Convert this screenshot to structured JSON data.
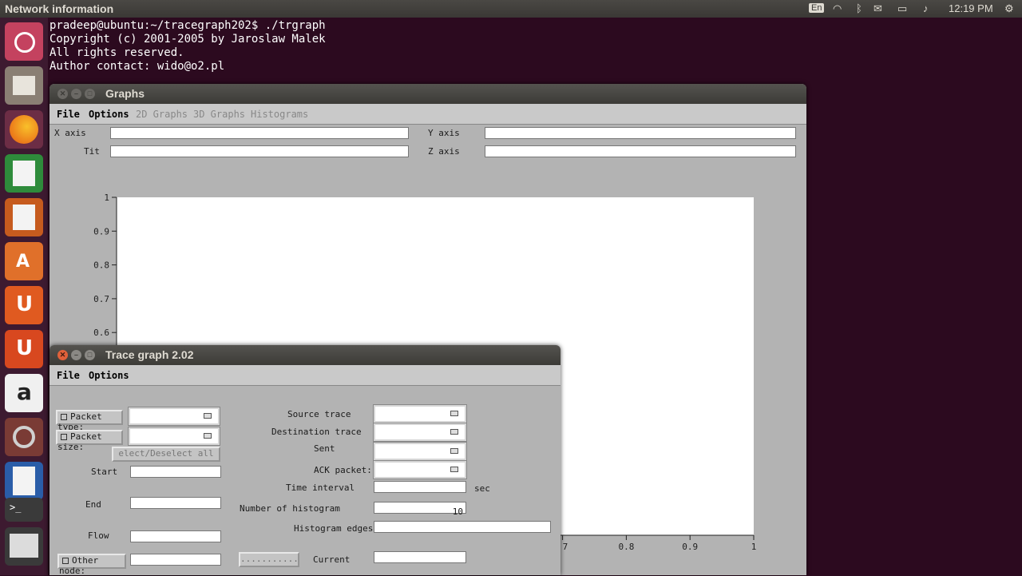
{
  "topbar": {
    "title": "Network information",
    "lang": "En",
    "time": "12:19 PM"
  },
  "terminal": {
    "lines": [
      "pradeep@ubuntu:~/tracegraph202$ ./trgraph",
      "Copyright (c) 2001-2005 by Jaroslaw Malek",
      "All rights reserved.",
      "Author contact: wido@o2.pl"
    ]
  },
  "graphs": {
    "title": "Graphs",
    "menu": {
      "file": "File",
      "options": "Options",
      "g2d": "2D Graphs",
      "g3d": "3D Graphs",
      "hist": "Histograms"
    },
    "xaxis": "X axis",
    "yaxis": "Y axis",
    "tit": "Tit",
    "zaxis": "Z axis"
  },
  "chart_data": {
    "type": "line",
    "series": [],
    "xlim": [
      0,
      1
    ],
    "ylim": [
      0,
      1
    ],
    "yticks": [
      "1",
      "0.9",
      "0.8",
      "0.7",
      "0.6"
    ],
    "xticks": [
      ".7",
      "0.8",
      "0.9",
      "1"
    ]
  },
  "trace": {
    "title": "Trace graph 2.02",
    "menu": {
      "file": "File",
      "options": "Options"
    },
    "packet_type": "Packet type:",
    "packet_size": "Packet size:",
    "select_all": "elect/Deselect all size",
    "start": "Start",
    "end": "End",
    "flow": "Flow",
    "other_node": "Other node:",
    "source_trace": "Source trace",
    "destination_trace": "Destination trace",
    "sent": "Sent",
    "ack_packet": "ACK packet:",
    "time_interval": "Time interval",
    "sec": "sec",
    "num_hist": "Number of histogram",
    "num_hist_value": "10",
    "hist_edges": "Histogram edges:",
    "current": "Current",
    "dots": "..........."
  }
}
